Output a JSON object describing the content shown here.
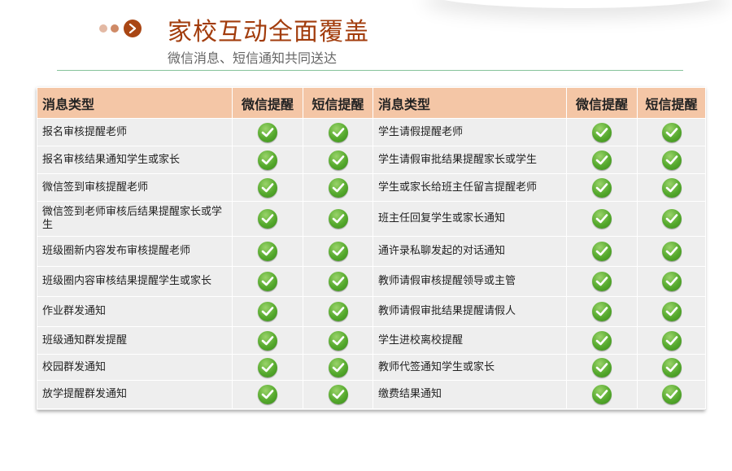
{
  "header": {
    "title": "家校互动全面覆盖",
    "subtitle": "微信消息、短信通知共同送达"
  },
  "colors": {
    "title": "#a23c0c",
    "header_bg": "#f4c6a6",
    "row_bg": "#eeeeee",
    "check_green": "#55a92d",
    "rule": "#86c39a"
  },
  "table": {
    "headers": [
      "消息类型",
      "微信提醒",
      "短信提醒",
      "消息类型",
      "微信提醒",
      "短信提醒"
    ],
    "rows": [
      {
        "left": "报名审核提醒老师",
        "right": "学生请假提醒老师"
      },
      {
        "left": "报名审核结果通知学生或家长",
        "right": "学生请假审批结果提醒家长或学生"
      },
      {
        "left": "微信签到审核提醒老师",
        "right": "学生或家长给班主任留言提醒老师"
      },
      {
        "left": "微信签到老师审核后结果提醒家长或学生",
        "right": "班主任回复学生或家长通知"
      },
      {
        "left": "班级圈新内容发布审核提醒老师",
        "right": "通许录私聊发起的对话通知"
      },
      {
        "left": "班级圈内容审核结果提醒学生或家长",
        "right": "教师请假审核提醒领导或主管"
      },
      {
        "left": "作业群发通知",
        "right": "教师请假审批结果提醒请假人"
      },
      {
        "left": "班级通知群发提醒",
        "right": "学生进校离校提醒"
      },
      {
        "left": "校园群发通知",
        "right": "教师代签通知学生或家长"
      },
      {
        "left": "放学提醒群发通知",
        "right": "缴费结果通知"
      }
    ],
    "check_icon": "check-circle-icon"
  }
}
